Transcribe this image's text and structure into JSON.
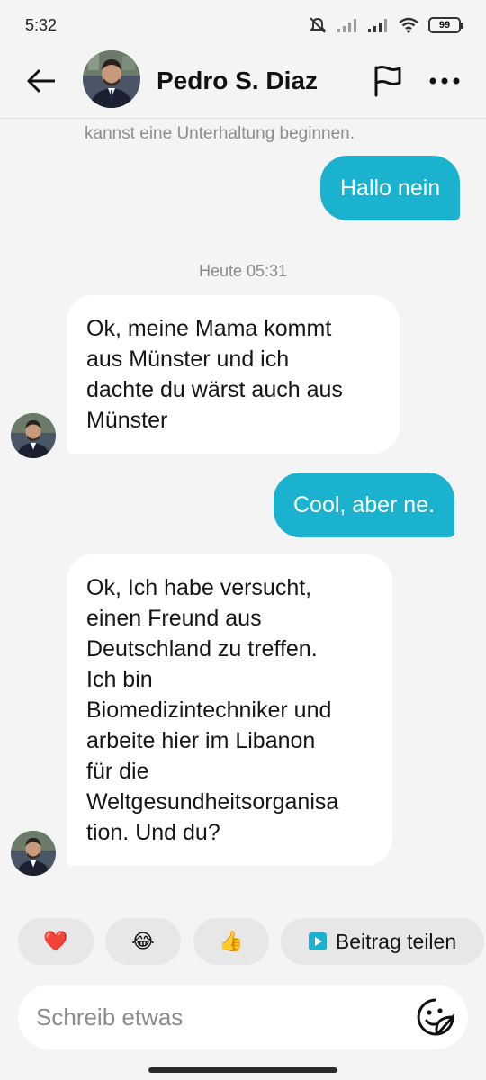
{
  "status_bar": {
    "time": "5:32",
    "battery": "99",
    "icons": [
      "mute-icon",
      "signal-icon",
      "signal-icon",
      "wifi-icon",
      "battery-icon"
    ]
  },
  "header": {
    "contact_name": "Pedro S. Diaz",
    "icons": [
      "back-arrow-icon",
      "flag-icon",
      "more-icon"
    ]
  },
  "chat": {
    "intro_text": "kannst eine Unterhaltung beginnen.",
    "date_separator": "Heute 05:31",
    "messages": [
      {
        "direction": "outgoing",
        "text": "Hallo nein"
      },
      {
        "direction": "incoming",
        "lines": [
          "Ok, meine Mama kommt",
          "aus Münster und ich",
          "dachte du wärst auch aus",
          "Münster"
        ]
      },
      {
        "direction": "outgoing",
        "text": "Cool, aber ne."
      },
      {
        "direction": "incoming",
        "lines": [
          "Ok, Ich habe versucht,",
          "einen Freund aus",
          "Deutschland zu treffen.",
          "Ich bin",
          "Biomedizintechniker und",
          "arbeite hier im Libanon",
          "für die",
          "Weltgesundheitsorganisa",
          "tion. Und du?"
        ]
      }
    ]
  },
  "reactions": {
    "items": [
      "❤️",
      "😂",
      "👍"
    ],
    "share_label": "Beitrag teilen"
  },
  "composer": {
    "placeholder": "Schreib etwas",
    "icon": "sticker-icon"
  },
  "colors": {
    "accent": "#1bb2cf",
    "background": "#f4f4f4",
    "incoming_bubble": "#ffffff"
  }
}
